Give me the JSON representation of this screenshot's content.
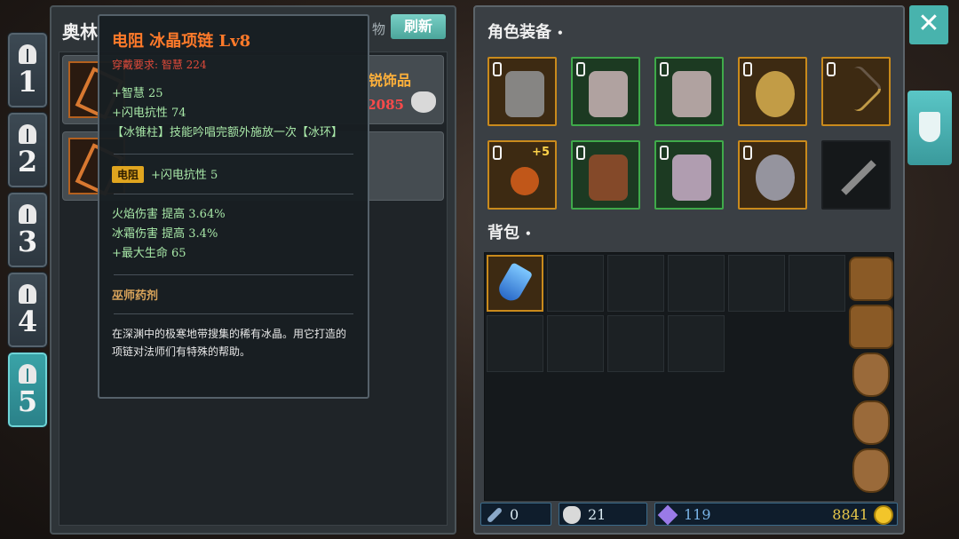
{
  "tabs": [
    {
      "num": "1",
      "active": false
    },
    {
      "num": "2",
      "active": false
    },
    {
      "num": "3",
      "active": false
    },
    {
      "num": "4",
      "active": false
    },
    {
      "num": "5",
      "active": true
    }
  ],
  "shop": {
    "title": "奥林",
    "refresh_prefix": "物",
    "refresh_label": "刷新",
    "items": [
      {
        "name": "锐饰品",
        "price": "2085"
      },
      {
        "name": "",
        "price": ""
      }
    ]
  },
  "tooltip": {
    "title": "电阻 冰晶项链 Lv8",
    "requirement": "穿戴要求: 智慧 224",
    "base_stats": [
      "+智慧 25",
      "+闪电抗性 74",
      "【冰锥柱】技能吟唱完额外施放一次【冰环】"
    ],
    "tag": "电阻",
    "tag_stat": "+闪电抗性 5",
    "bonus_stats": [
      "火焰伤害 提高 3.64%",
      "冰霜伤害 提高 3.4%",
      "+最大生命 65"
    ],
    "set_name": "巫师药剂",
    "description": "在深渊中的极寒地带搜集的稀有冰晶。用它打造的项链对法师们有特殊的帮助。"
  },
  "character": {
    "equipment_label": "角色装备",
    "bag_label": "背包",
    "equip_slots": [
      {
        "icon": "helmet-icon",
        "rarity": "gold"
      },
      {
        "icon": "chest-armor-icon",
        "rarity": "green"
      },
      {
        "icon": "robe-armor-icon",
        "rarity": "green"
      },
      {
        "icon": "spiked-ring-icon",
        "rarity": "gold"
      },
      {
        "icon": "bow-icon",
        "rarity": "gold"
      },
      {
        "icon": "amulet-icon",
        "rarity": "gold",
        "enhance": "+5"
      },
      {
        "icon": "gloves-icon",
        "rarity": "green"
      },
      {
        "icon": "boots-icon",
        "rarity": "green"
      },
      {
        "icon": "ring-icon",
        "rarity": "gold"
      },
      {
        "icon": "sword-icon",
        "rarity": "empty"
      }
    ],
    "bag_side_icons": [
      "backpack-icon",
      "backpack-icon",
      "pouch-icon",
      "sack-icon",
      "sack-icon"
    ]
  },
  "currency": {
    "wand": "0",
    "potion": "21",
    "gem": "119",
    "gold": "8841"
  },
  "colors": {
    "teal_accent": "#48b3ad",
    "gold_border": "#c98a1c",
    "green_border": "#3faa4a",
    "title_orange": "#ff7a2a",
    "stat_green": "#a8e8a8"
  }
}
